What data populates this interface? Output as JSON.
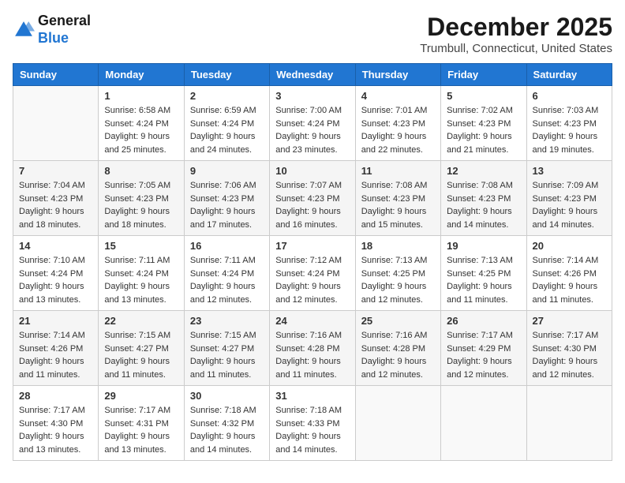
{
  "header": {
    "logo_general": "General",
    "logo_blue": "Blue",
    "month_year": "December 2025",
    "location": "Trumbull, Connecticut, United States"
  },
  "days_of_week": [
    "Sunday",
    "Monday",
    "Tuesday",
    "Wednesday",
    "Thursday",
    "Friday",
    "Saturday"
  ],
  "weeks": [
    [
      {
        "day": "",
        "sunrise": "",
        "sunset": "",
        "daylight": ""
      },
      {
        "day": "1",
        "sunrise": "Sunrise: 6:58 AM",
        "sunset": "Sunset: 4:24 PM",
        "daylight": "Daylight: 9 hours and 25 minutes."
      },
      {
        "day": "2",
        "sunrise": "Sunrise: 6:59 AM",
        "sunset": "Sunset: 4:24 PM",
        "daylight": "Daylight: 9 hours and 24 minutes."
      },
      {
        "day": "3",
        "sunrise": "Sunrise: 7:00 AM",
        "sunset": "Sunset: 4:24 PM",
        "daylight": "Daylight: 9 hours and 23 minutes."
      },
      {
        "day": "4",
        "sunrise": "Sunrise: 7:01 AM",
        "sunset": "Sunset: 4:23 PM",
        "daylight": "Daylight: 9 hours and 22 minutes."
      },
      {
        "day": "5",
        "sunrise": "Sunrise: 7:02 AM",
        "sunset": "Sunset: 4:23 PM",
        "daylight": "Daylight: 9 hours and 21 minutes."
      },
      {
        "day": "6",
        "sunrise": "Sunrise: 7:03 AM",
        "sunset": "Sunset: 4:23 PM",
        "daylight": "Daylight: 9 hours and 19 minutes."
      }
    ],
    [
      {
        "day": "7",
        "sunrise": "Sunrise: 7:04 AM",
        "sunset": "Sunset: 4:23 PM",
        "daylight": "Daylight: 9 hours and 18 minutes."
      },
      {
        "day": "8",
        "sunrise": "Sunrise: 7:05 AM",
        "sunset": "Sunset: 4:23 PM",
        "daylight": "Daylight: 9 hours and 18 minutes."
      },
      {
        "day": "9",
        "sunrise": "Sunrise: 7:06 AM",
        "sunset": "Sunset: 4:23 PM",
        "daylight": "Daylight: 9 hours and 17 minutes."
      },
      {
        "day": "10",
        "sunrise": "Sunrise: 7:07 AM",
        "sunset": "Sunset: 4:23 PM",
        "daylight": "Daylight: 9 hours and 16 minutes."
      },
      {
        "day": "11",
        "sunrise": "Sunrise: 7:08 AM",
        "sunset": "Sunset: 4:23 PM",
        "daylight": "Daylight: 9 hours and 15 minutes."
      },
      {
        "day": "12",
        "sunrise": "Sunrise: 7:08 AM",
        "sunset": "Sunset: 4:23 PM",
        "daylight": "Daylight: 9 hours and 14 minutes."
      },
      {
        "day": "13",
        "sunrise": "Sunrise: 7:09 AM",
        "sunset": "Sunset: 4:23 PM",
        "daylight": "Daylight: 9 hours and 14 minutes."
      }
    ],
    [
      {
        "day": "14",
        "sunrise": "Sunrise: 7:10 AM",
        "sunset": "Sunset: 4:24 PM",
        "daylight": "Daylight: 9 hours and 13 minutes."
      },
      {
        "day": "15",
        "sunrise": "Sunrise: 7:11 AM",
        "sunset": "Sunset: 4:24 PM",
        "daylight": "Daylight: 9 hours and 13 minutes."
      },
      {
        "day": "16",
        "sunrise": "Sunrise: 7:11 AM",
        "sunset": "Sunset: 4:24 PM",
        "daylight": "Daylight: 9 hours and 12 minutes."
      },
      {
        "day": "17",
        "sunrise": "Sunrise: 7:12 AM",
        "sunset": "Sunset: 4:24 PM",
        "daylight": "Daylight: 9 hours and 12 minutes."
      },
      {
        "day": "18",
        "sunrise": "Sunrise: 7:13 AM",
        "sunset": "Sunset: 4:25 PM",
        "daylight": "Daylight: 9 hours and 12 minutes."
      },
      {
        "day": "19",
        "sunrise": "Sunrise: 7:13 AM",
        "sunset": "Sunset: 4:25 PM",
        "daylight": "Daylight: 9 hours and 11 minutes."
      },
      {
        "day": "20",
        "sunrise": "Sunrise: 7:14 AM",
        "sunset": "Sunset: 4:26 PM",
        "daylight": "Daylight: 9 hours and 11 minutes."
      }
    ],
    [
      {
        "day": "21",
        "sunrise": "Sunrise: 7:14 AM",
        "sunset": "Sunset: 4:26 PM",
        "daylight": "Daylight: 9 hours and 11 minutes."
      },
      {
        "day": "22",
        "sunrise": "Sunrise: 7:15 AM",
        "sunset": "Sunset: 4:27 PM",
        "daylight": "Daylight: 9 hours and 11 minutes."
      },
      {
        "day": "23",
        "sunrise": "Sunrise: 7:15 AM",
        "sunset": "Sunset: 4:27 PM",
        "daylight": "Daylight: 9 hours and 11 minutes."
      },
      {
        "day": "24",
        "sunrise": "Sunrise: 7:16 AM",
        "sunset": "Sunset: 4:28 PM",
        "daylight": "Daylight: 9 hours and 11 minutes."
      },
      {
        "day": "25",
        "sunrise": "Sunrise: 7:16 AM",
        "sunset": "Sunset: 4:28 PM",
        "daylight": "Daylight: 9 hours and 12 minutes."
      },
      {
        "day": "26",
        "sunrise": "Sunrise: 7:17 AM",
        "sunset": "Sunset: 4:29 PM",
        "daylight": "Daylight: 9 hours and 12 minutes."
      },
      {
        "day": "27",
        "sunrise": "Sunrise: 7:17 AM",
        "sunset": "Sunset: 4:30 PM",
        "daylight": "Daylight: 9 hours and 12 minutes."
      }
    ],
    [
      {
        "day": "28",
        "sunrise": "Sunrise: 7:17 AM",
        "sunset": "Sunset: 4:30 PM",
        "daylight": "Daylight: 9 hours and 13 minutes."
      },
      {
        "day": "29",
        "sunrise": "Sunrise: 7:17 AM",
        "sunset": "Sunset: 4:31 PM",
        "daylight": "Daylight: 9 hours and 13 minutes."
      },
      {
        "day": "30",
        "sunrise": "Sunrise: 7:18 AM",
        "sunset": "Sunset: 4:32 PM",
        "daylight": "Daylight: 9 hours and 14 minutes."
      },
      {
        "day": "31",
        "sunrise": "Sunrise: 7:18 AM",
        "sunset": "Sunset: 4:33 PM",
        "daylight": "Daylight: 9 hours and 14 minutes."
      },
      {
        "day": "",
        "sunrise": "",
        "sunset": "",
        "daylight": ""
      },
      {
        "day": "",
        "sunrise": "",
        "sunset": "",
        "daylight": ""
      },
      {
        "day": "",
        "sunrise": "",
        "sunset": "",
        "daylight": ""
      }
    ]
  ]
}
